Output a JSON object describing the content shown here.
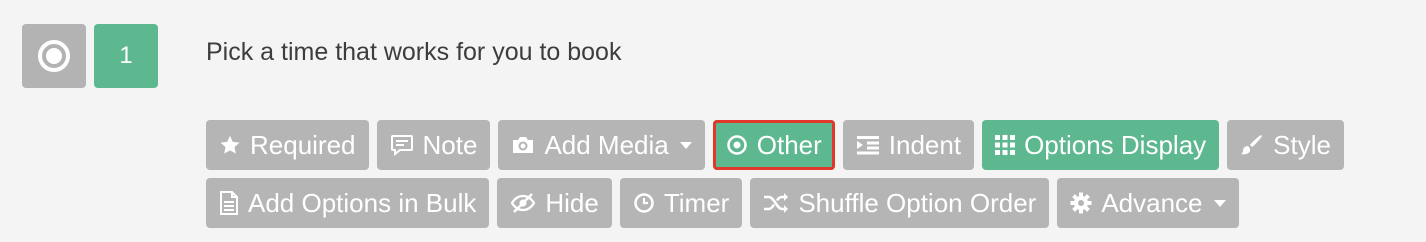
{
  "question": {
    "number": "1",
    "title": "Pick a time that works for you to book",
    "type_icon": "radio-button-icon"
  },
  "toolbar": {
    "row1": [
      {
        "label": "Required",
        "icon": "star-icon"
      },
      {
        "label": "Note",
        "icon": "comment-icon"
      },
      {
        "label": "Add Media",
        "icon": "camera-icon",
        "dropdown": true
      },
      {
        "label": "Other",
        "icon": "dot-circle-icon",
        "active": true,
        "highlighted": true
      },
      {
        "label": "Indent",
        "icon": "indent-icon"
      },
      {
        "label": "Options Display",
        "icon": "grid-icon",
        "active": true
      },
      {
        "label": "Style",
        "icon": "paint-brush-icon"
      }
    ],
    "row2": [
      {
        "label": "Add Options in Bulk",
        "icon": "document-icon"
      },
      {
        "label": "Hide",
        "icon": "eye-slash-icon"
      },
      {
        "label": "Timer",
        "icon": "clock-icon"
      },
      {
        "label": "Shuffle Option Order",
        "icon": "shuffle-icon"
      },
      {
        "label": "Advance",
        "icon": "gear-icon",
        "dropdown": true
      }
    ]
  },
  "colors": {
    "inactive_button": "#b5b5b5",
    "active_button": "#5eb88f",
    "highlight_border": "#e0392b",
    "question_number_bg": "#5eb88f",
    "type_icon_bg": "#b3b3b3"
  }
}
